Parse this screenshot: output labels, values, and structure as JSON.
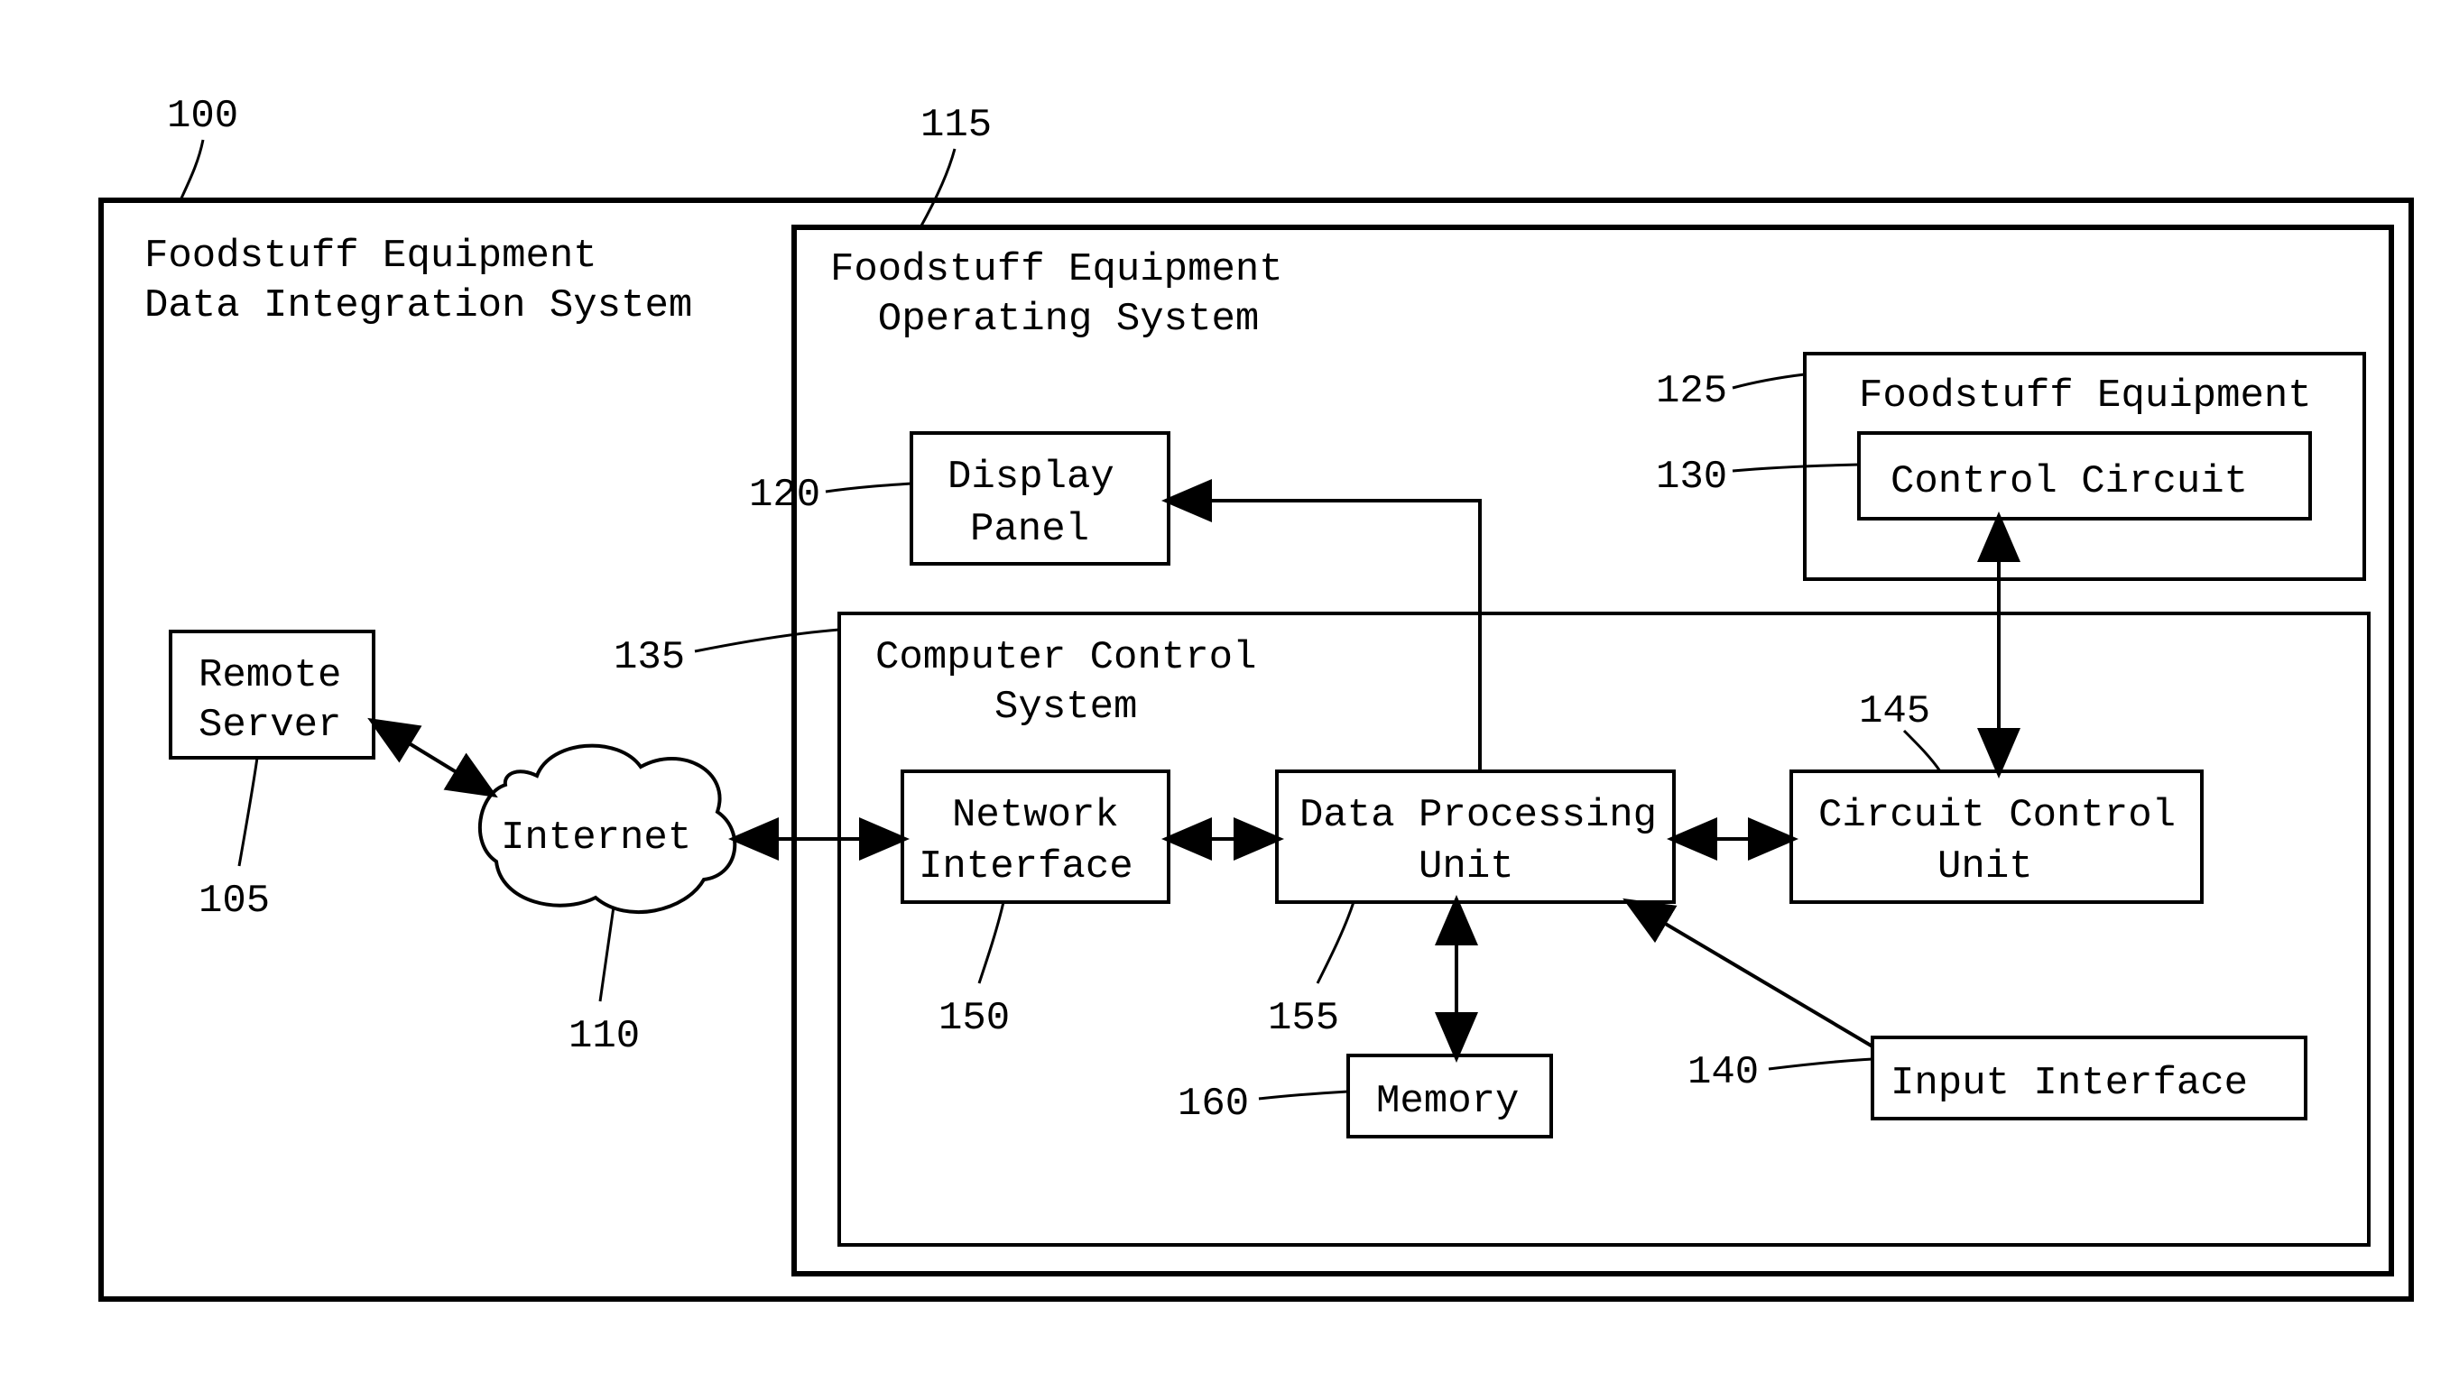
{
  "numbers": {
    "n100": "100",
    "n115": "115",
    "n125": "125",
    "n130": "130",
    "n120": "120",
    "n135": "135",
    "n105": "105",
    "n110": "110",
    "n150": "150",
    "n155": "155",
    "n160": "160",
    "n140": "140",
    "n145": "145"
  },
  "labels": {
    "outer_l1": "Foodstuff Equipment",
    "outer_l2": "Data Integration System",
    "opsys_l1": "Foodstuff Equipment",
    "opsys_l2": "  Operating System",
    "equip_l1": "Foodstuff Equipment",
    "ctrlckt": "Control Circuit",
    "display_l1": "Display",
    "display_l2": "Panel",
    "remote_l1": "Remote",
    "remote_l2": "Server",
    "internet": "Internet",
    "ccs_l1": "Computer Control",
    "ccs_l2": "     System",
    "net_l1": "Network",
    "net_l2": "Interface",
    "dpu_l1": "Data Processing",
    "dpu_l2": "     Unit",
    "ccu_l1": "Circuit Control",
    "ccu_l2": "     Unit",
    "memory": "Memory",
    "input": "Input Interface"
  }
}
